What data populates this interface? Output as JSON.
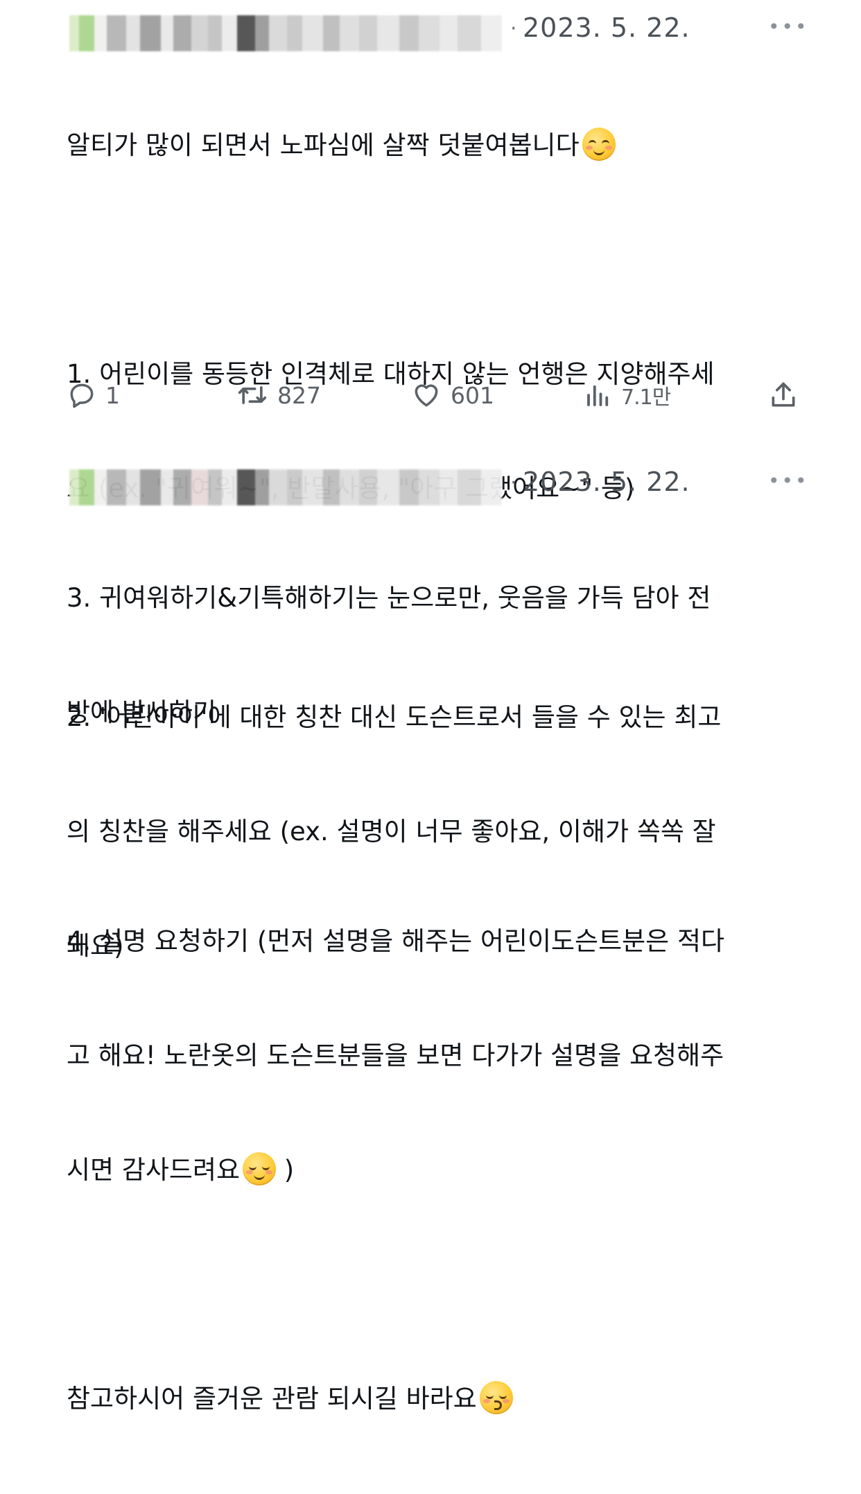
{
  "colors": {
    "text": "#101418",
    "secondary": "#5b6167",
    "background": "#ffffff"
  },
  "tweets": [
    {
      "username_blurred": true,
      "separator": "·",
      "date": "2023. 5. 22.",
      "more_label": "•••",
      "lines": [
        "알티가 많이 되면서 노파심에 살짝 덧붙여봅니다",
        "",
        "1. 어린이를 동등한 인격체로 대하지 않는 언행은 지양해주세",
        "요 (ex. \"귀여워~\", 반말사용, \"아구 그랬어요~\" 등)",
        "",
        "2. '어린아이'에 대한 칭찬 대신 도슨트로서 들을 수 있는 최고",
        "의 칭찬을 해주세요 (ex. 설명이 너무 좋아요, 이해가 쏙쏙 잘",
        "돼요)"
      ],
      "emoji_after_line_0": "relieved-face",
      "actions": {
        "reply_icon": "reply-bubble-icon",
        "reply_count": "1",
        "retweet_icon": "retweet-icon",
        "retweet_count": "827",
        "like_icon": "heart-icon",
        "like_count": "601",
        "views_icon": "views-bar-icon",
        "views_count": "7.1만",
        "share_icon": "share-upload-icon"
      }
    },
    {
      "username_blurred": true,
      "separator": "·",
      "date": "2023. 5. 22.",
      "more_label": "•••",
      "lines": [
        "3. 귀여워하기&기특해하기는 눈으로만, 웃음을 가득 담아 전",
        "방에 발사하기",
        "",
        "4. 설명 요청하기 (먼저 설명을 해주는 어린이도슨트분은 적다",
        "고 해요! 노란옷의 도슨트분들을 보면 다가가 설명을 요청해주",
        "시면 감사드려요",
        "",
        "참고하시어 즐거운 관람 되시길 바라요"
      ],
      "line_5_suffix": " )",
      "emoji_in_line_5": "smiling-face",
      "emoji_after_line_7": "kissing-face"
    }
  ]
}
